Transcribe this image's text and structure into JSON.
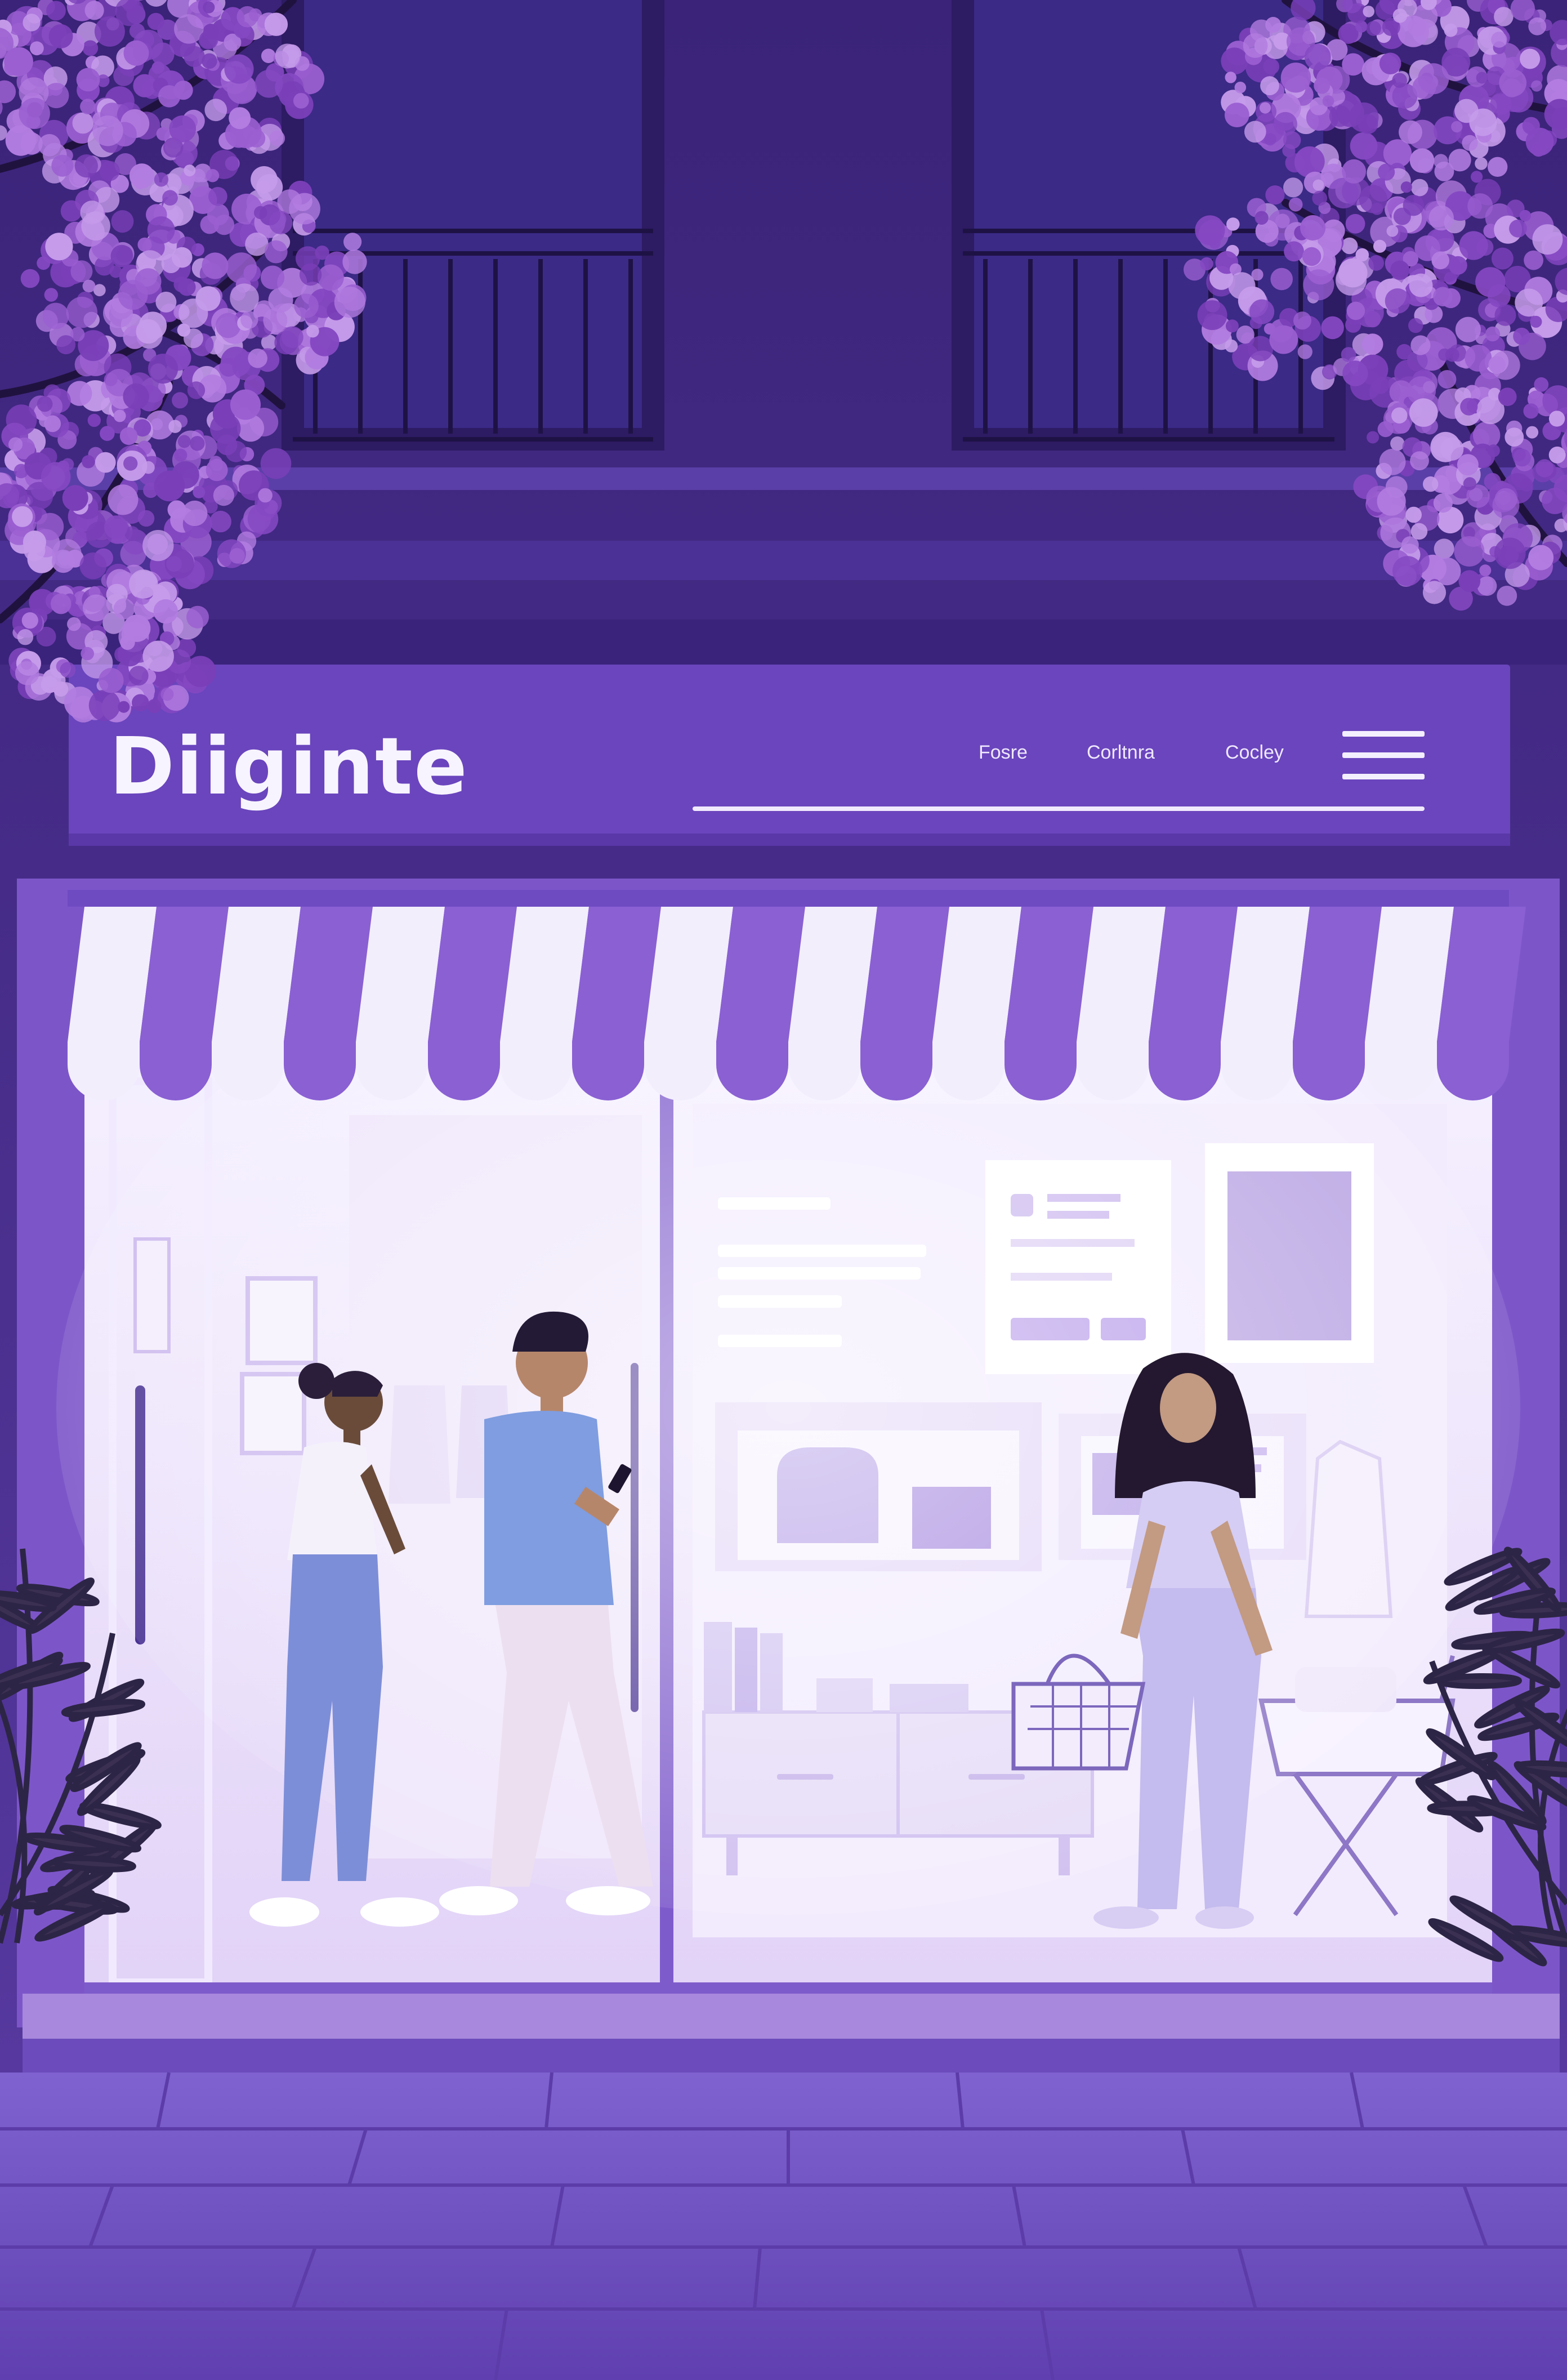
{
  "storefront": {
    "brand": "Diiginte",
    "nav": [
      "Fosre",
      "Corltnra",
      "Cocley"
    ],
    "menu_icon": "hamburger-menu-icon"
  },
  "palette": {
    "sky_wall": "#4a2f8c",
    "signboard": "#6a45bd",
    "awning_purple": "#8a60d3",
    "awning_white": "#f3eefc",
    "interior": "#ece2fa",
    "pavement": "#7456c5",
    "blossom": "#9b5fd1"
  }
}
